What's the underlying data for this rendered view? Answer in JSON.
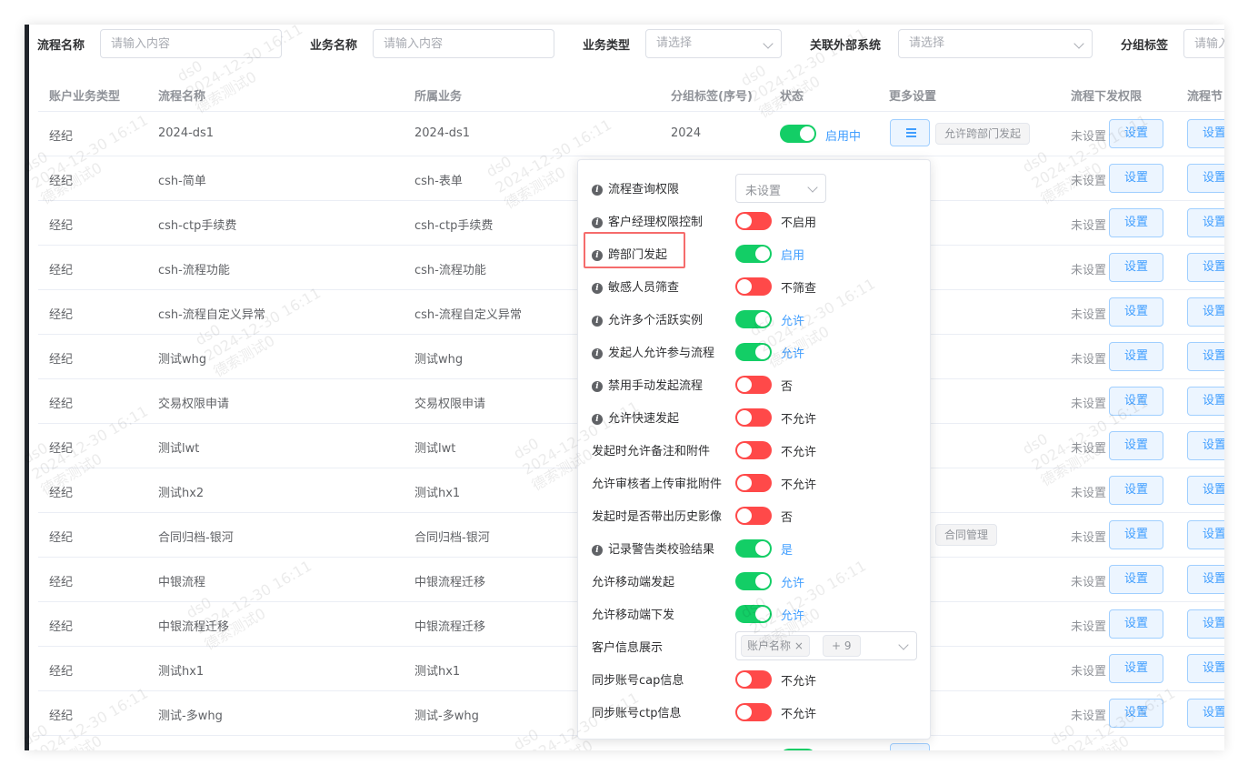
{
  "filters": {
    "process_name_label": "流程名称",
    "process_name_placeholder": "请输入内容",
    "business_name_label": "业务名称",
    "business_name_placeholder": "请输入内容",
    "business_type_label": "业务类型",
    "business_type_placeholder": "请选择",
    "external_system_label": "关联外部系统",
    "external_system_placeholder": "请选择",
    "group_tag_label": "分组标签",
    "group_tag_placeholder": "请输入"
  },
  "columns": [
    "账户业务类型",
    "流程名称",
    "所属业务",
    "分组标签(序号)",
    "状态",
    "更多设置",
    "流程下发权限",
    "流程节"
  ],
  "first_row": {
    "status_text": "启用中",
    "more_tag": "允许跨部门发起"
  },
  "rows": [
    {
      "type": "经纪",
      "name": "2024-ds1",
      "business": "2024-ds1",
      "group": "2024",
      "perm": "未设置",
      "btn": "设置",
      "btn2": "设置"
    },
    {
      "type": "经纪",
      "name": "csh-简单",
      "business": "csh-表单",
      "group": "",
      "perm": "未设置",
      "btn": "设置",
      "btn2": "设置"
    },
    {
      "type": "经纪",
      "name": "csh-ctp手续费",
      "business": "csh-ctp手续费",
      "group": "",
      "perm": "未设置",
      "btn": "设置",
      "btn2": "设置"
    },
    {
      "type": "经纪",
      "name": "csh-流程功能",
      "business": "csh-流程功能",
      "group": "",
      "perm": "未设置",
      "btn": "设置",
      "btn2": "设置"
    },
    {
      "type": "经纪",
      "name": "csh-流程自定义异常",
      "business": "csh-流程自定义异常",
      "group": "",
      "perm": "未设置",
      "btn": "设置",
      "btn2": "设置"
    },
    {
      "type": "经纪",
      "name": "测试whg",
      "business": "测试whg",
      "group": "",
      "perm": "未设置",
      "btn": "设置",
      "btn2": "设置"
    },
    {
      "type": "经纪",
      "name": "交易权限申请",
      "business": "交易权限申请",
      "group": "",
      "perm": "未设置",
      "btn": "设置",
      "btn2": "设置"
    },
    {
      "type": "经纪",
      "name": "测试lwt",
      "business": "测试lwt",
      "group": "",
      "perm": "未设置",
      "btn": "设置",
      "btn2": "设置"
    },
    {
      "type": "经纪",
      "name": "测试hx2",
      "business": "测试hx1",
      "group": "",
      "perm": "未设置",
      "btn": "设置",
      "btn2": "设置"
    },
    {
      "type": "经纪",
      "name": "合同归档-银河",
      "business": "合同归档-银河",
      "group": "",
      "perm": "未设置",
      "btn": "设置",
      "btn2": "设置",
      "tag": "合同管理"
    },
    {
      "type": "经纪",
      "name": "中银流程",
      "business": "中银流程迁移",
      "group": "",
      "perm": "未设置",
      "btn": "设置",
      "btn2": "设置"
    },
    {
      "type": "经纪",
      "name": "中银流程迁移",
      "business": "中银流程迁移",
      "group": "",
      "perm": "未设置",
      "btn": "设置",
      "btn2": "设置"
    },
    {
      "type": "经纪",
      "name": "测试hx1",
      "business": "测试hx1",
      "group": "",
      "perm": "未设置",
      "btn": "设置",
      "btn2": "设置"
    },
    {
      "type": "经纪",
      "name": "测试-多whg",
      "business": "测试-多whg",
      "group": "",
      "perm": "未设置",
      "btn": "设置",
      "btn2": "设置"
    }
  ],
  "popover": {
    "query_perm_label": "流程查询权限",
    "query_perm_value": "未设置",
    "items": [
      {
        "label": "客户经理权限控制",
        "info": true,
        "on": false,
        "state": "不启用"
      },
      {
        "label": "跨部门发起",
        "info": true,
        "on": true,
        "state": "启用"
      },
      {
        "label": "敏感人员筛查",
        "info": true,
        "on": false,
        "state": "不筛查"
      },
      {
        "label": "允许多个活跃实例",
        "info": true,
        "on": true,
        "state": "允许"
      },
      {
        "label": "发起人允许参与流程",
        "info": true,
        "on": true,
        "state": "允许"
      },
      {
        "label": "禁用手动发起流程",
        "info": true,
        "on": false,
        "state": "否"
      },
      {
        "label": "允许快速发起",
        "info": true,
        "on": false,
        "state": "不允许"
      },
      {
        "label": "发起时允许备注和附件",
        "info": false,
        "on": false,
        "state": "不允许"
      },
      {
        "label": "允许审核者上传审批附件",
        "info": false,
        "on": false,
        "state": "不允许"
      },
      {
        "label": "发起时是否带出历史影像",
        "info": false,
        "on": false,
        "state": "否"
      },
      {
        "label": "记录警告类校验结果",
        "info": true,
        "on": true,
        "state": "是"
      },
      {
        "label": "允许移动端发起",
        "info": false,
        "on": true,
        "state": "允许"
      },
      {
        "label": "允许移动端下发",
        "info": false,
        "on": true,
        "state": "允许"
      }
    ],
    "customer_info_label": "客户信息展示",
    "customer_info_tag": "账户名称",
    "customer_info_more": "+ 9",
    "sync_cap_label": "同步账号cap信息",
    "sync_cap_state": "不允许",
    "sync_ctp_label": "同步账号ctp信息",
    "sync_ctp_state": "不允许"
  },
  "watermark": {
    "line1": "ds0",
    "line2": "2024-12-30 16:11",
    "line3": "德索测试0"
  },
  "colors": {
    "switch_on": "#13ce66",
    "switch_off": "#ff4949",
    "primary": "#409eff",
    "highlight": "#f56c6c"
  }
}
